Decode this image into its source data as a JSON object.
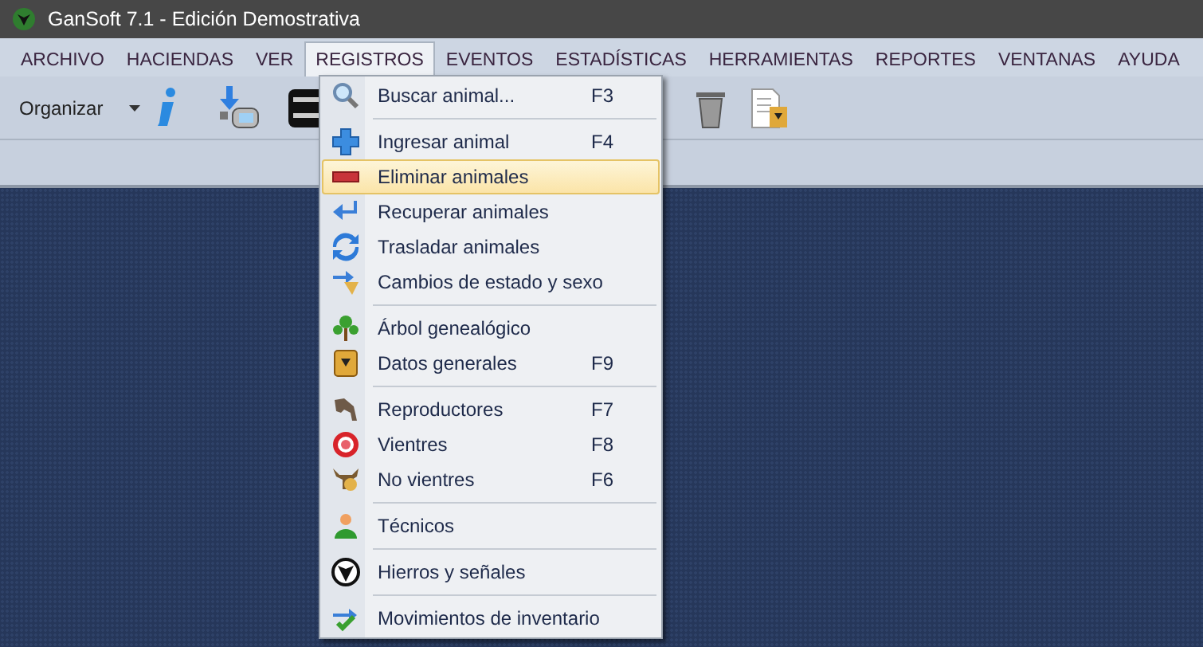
{
  "window": {
    "title": "GanSoft 7.1 - Edición Demostrativa"
  },
  "menu_bar": [
    {
      "label": "ARCHIVO",
      "selected": false
    },
    {
      "label": "HACIENDAS",
      "selected": false
    },
    {
      "label": "VER",
      "selected": false
    },
    {
      "label": "REGISTROS",
      "selected": true
    },
    {
      "label": "EVENTOS",
      "selected": false
    },
    {
      "label": "ESTADÍSTICAS",
      "selected": false
    },
    {
      "label": "HERRAMIENTAS",
      "selected": false
    },
    {
      "label": "REPORTES",
      "selected": false
    },
    {
      "label": "VENTANAS",
      "selected": false
    },
    {
      "label": "AYUDA",
      "selected": false
    }
  ],
  "toolbar": {
    "organize_label": "Organizar"
  },
  "dropdown": [
    {
      "kind": "item",
      "label": "Buscar animal...",
      "shortcut": "F3",
      "selected": false
    },
    {
      "kind": "separator"
    },
    {
      "kind": "item",
      "label": "Ingresar animal",
      "shortcut": "F4",
      "selected": false
    },
    {
      "kind": "item",
      "label": "Eliminar animales",
      "selected": true
    },
    {
      "kind": "item",
      "label": "Recuperar animales",
      "selected": false
    },
    {
      "kind": "item",
      "label": "Trasladar animales",
      "selected": false
    },
    {
      "kind": "item",
      "label": "Cambios de estado y sexo",
      "selected": false
    },
    {
      "kind": "separator"
    },
    {
      "kind": "item",
      "label": "Árbol genealógico",
      "selected": false
    },
    {
      "kind": "item",
      "label": "Datos generales",
      "shortcut": "F9",
      "selected": false
    },
    {
      "kind": "separator"
    },
    {
      "kind": "item",
      "label": "Reproductores",
      "shortcut": "F7",
      "selected": false
    },
    {
      "kind": "item",
      "label": "Vientres",
      "shortcut": "F8",
      "selected": false
    },
    {
      "kind": "item",
      "label": "No vientres",
      "shortcut": "F6",
      "selected": false
    },
    {
      "kind": "separator"
    },
    {
      "kind": "item",
      "label": "Técnicos",
      "selected": false
    },
    {
      "kind": "separator"
    },
    {
      "kind": "item",
      "label": "Hierros y señales",
      "selected": false
    },
    {
      "kind": "separator"
    },
    {
      "kind": "item",
      "label": "Movimientos de inventario",
      "selected": false
    }
  ]
}
